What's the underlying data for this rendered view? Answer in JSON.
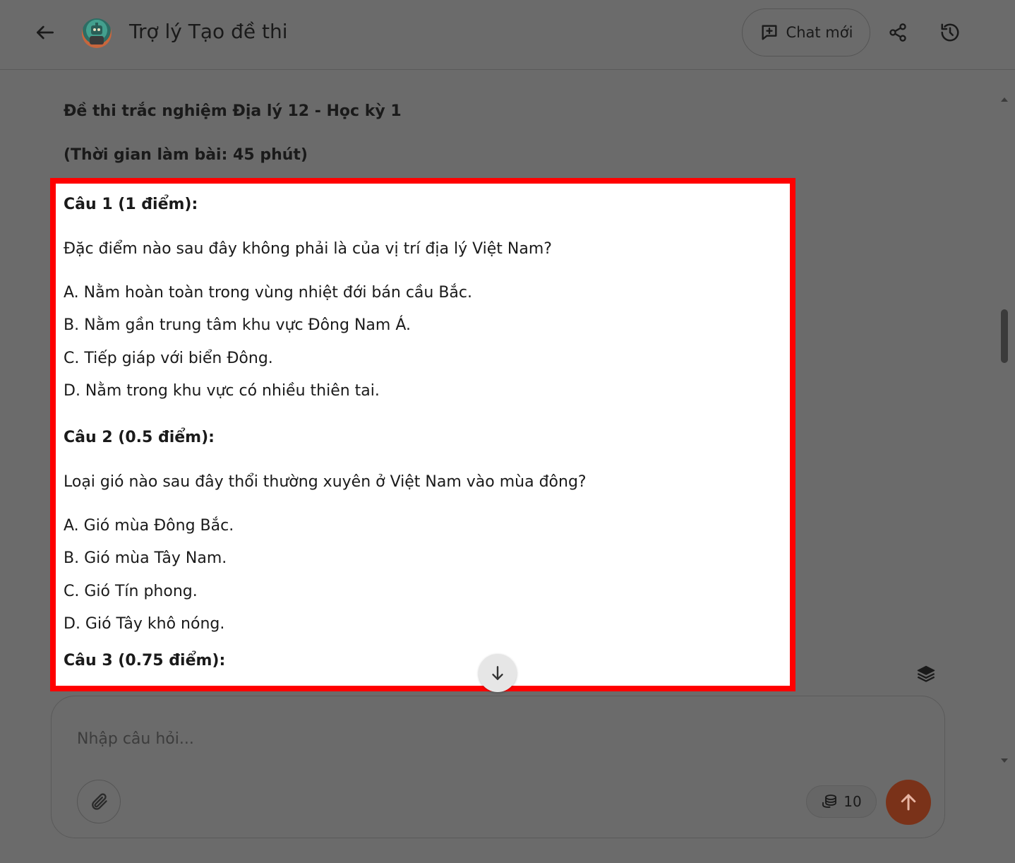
{
  "header": {
    "title": "Trợ lý Tạo đề thi",
    "new_chat_label": "Chat mới"
  },
  "document": {
    "title": "Đề thi trắc nghiệm Địa lý 12 - Học kỳ 1",
    "time": "(Thời gian làm bài: 45 phút)"
  },
  "questions": [
    {
      "heading": "Câu 1 (1 điểm):",
      "text": "Đặc điểm nào sau đây không phải là của vị trí địa lý Việt Nam?",
      "options": [
        "A. Nằm hoàn toàn trong vùng nhiệt đới bán cầu Bắc.",
        "B. Nằm gần trung tâm khu vực Đông Nam Á.",
        "C. Tiếp giáp với biển Đông.",
        "D. Nằm trong khu vực có nhiều thiên tai."
      ]
    },
    {
      "heading": "Câu 2 (0.5 điểm):",
      "text": "Loại gió nào sau đây thổi thường xuyên ở Việt Nam vào mùa đông?",
      "options": [
        "A. Gió mùa Đông Bắc.",
        "B. Gió mùa Tây Nam.",
        "C. Gió Tín phong.",
        "D. Gió Tây khô nóng."
      ]
    },
    {
      "heading": "Câu 3 (0.75 điểm):"
    }
  ],
  "composer": {
    "placeholder": "Nhập câu hỏi...",
    "credits": "10"
  },
  "icons": {
    "back": "arrow-left-icon",
    "new_chat": "message-plus-icon",
    "share": "share-icon",
    "history": "history-icon",
    "scroll_down": "arrow-down-icon",
    "layers": "layers-icon",
    "attach": "paperclip-icon",
    "credits": "coins-icon",
    "send": "arrow-up-icon"
  },
  "colors": {
    "highlight_border": "#ff0000",
    "send_button": "#7a3219",
    "overlay_background": "#6b6b6b"
  }
}
